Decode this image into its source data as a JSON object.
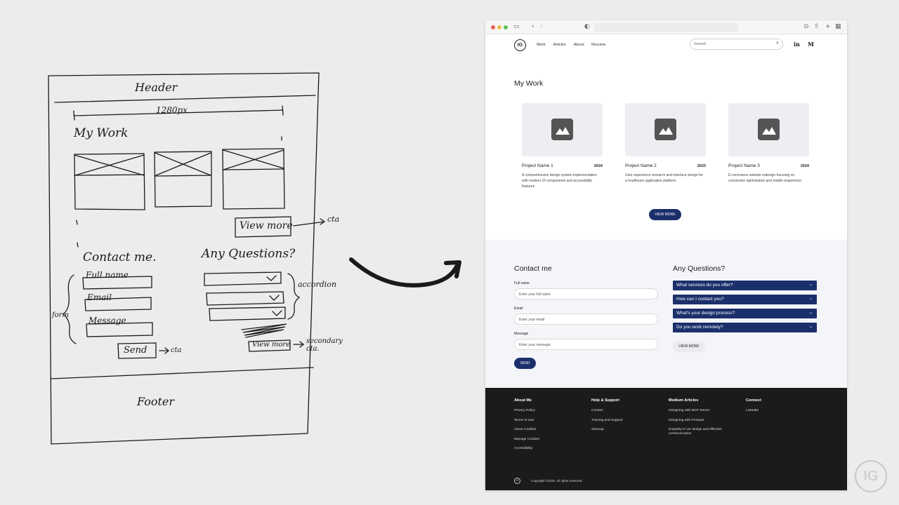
{
  "sketch": {
    "header": "Header",
    "width_label": "1280px",
    "my_work": "My Work",
    "view_more": "View more",
    "cta1": "cta",
    "contact": "Contact me.",
    "questions": "Any Questions?",
    "full_name": "Full name",
    "email": "Email",
    "message": "Message",
    "accordion": "accordion",
    "form": "form",
    "view_more_small": "View more",
    "secondary_cta": "secondary cta.",
    "send": "Send",
    "cta2": "cta",
    "footer": "Footer"
  },
  "site": {
    "logo": "IG",
    "nav": [
      "Work",
      "Articles",
      "About",
      "Resume"
    ],
    "search_placeholder": "Search",
    "social": [
      "in",
      "M"
    ],
    "work_title": "My Work",
    "projects": [
      {
        "name": "Project Name 1",
        "year": "2024",
        "desc": "A comprehensive design system implementation with modern UI components and accessibility features."
      },
      {
        "name": "Project Name 2",
        "year": "2023",
        "desc": "User experience research and interface design for a healthcare application platform."
      },
      {
        "name": "Project Name 3",
        "year": "2024",
        "desc": "E-commerce website redesign focusing on conversion optimization and mobile experience."
      }
    ],
    "view_more": "VIEW MORE",
    "contact_title": "Contact me",
    "fields": [
      {
        "label": "Full name",
        "placeholder": "Enter your full name"
      },
      {
        "label": "Email",
        "placeholder": "Enter your email"
      },
      {
        "label": "Message",
        "placeholder": "Enter your message"
      }
    ],
    "send": "SEND",
    "questions_title": "Any Questions?",
    "faq": [
      "What services do you offer?",
      "How can I contact you?",
      "What's your design process?",
      "Do you work remotely?"
    ],
    "view_more_secondary": "VIEW MORE",
    "footer": {
      "columns": [
        {
          "head": "About Me",
          "links": [
            "Privacy Policy",
            "Terms of Use",
            "About Cookies",
            "Manage Cookies",
            "Accessibility"
          ]
        },
        {
          "head": "Help & Support",
          "links": [
            "Contact",
            "Training and Support",
            "Sitemap"
          ]
        },
        {
          "head": "Medium Articles",
          "links": [
            "Designing with MCP Server",
            "Designing with Prompts",
            "Empathy in UX design and effective communication"
          ]
        },
        {
          "head": "Connect",
          "links": [
            "LinkedIn"
          ]
        }
      ],
      "logo": "IG",
      "copyright": "Copyright ©2025. All rights reserved."
    }
  },
  "brand_mark": "IG",
  "colors": {
    "primary": "#1b2f6b",
    "footer_bg": "#1b1b1b",
    "band_bg": "#f4f5f8"
  }
}
